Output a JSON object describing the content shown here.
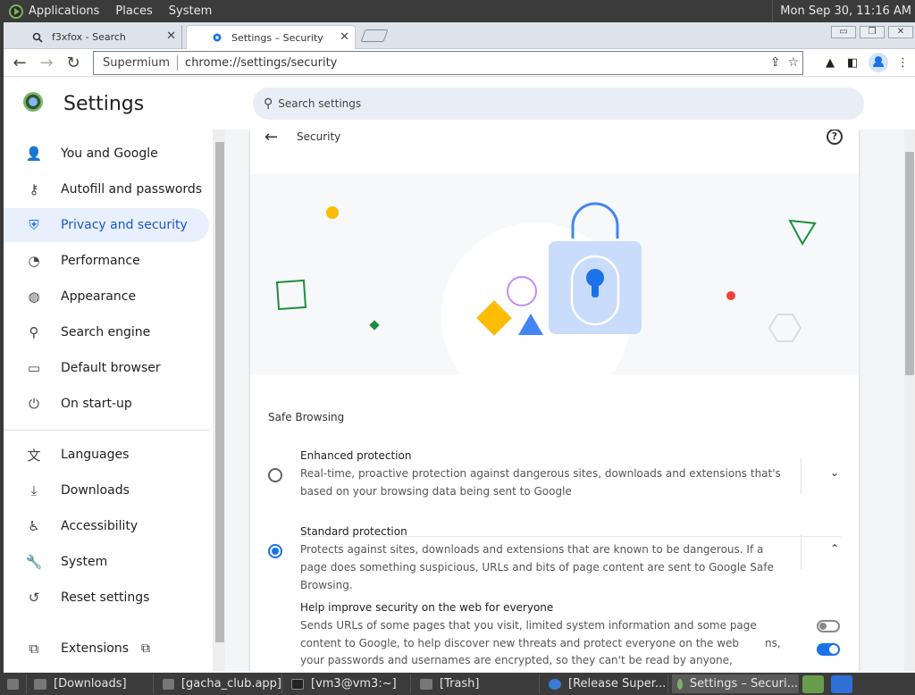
{
  "top_panel": {
    "applications": "Applications",
    "places": "Places",
    "system": "System",
    "clock": "Mon Sep 30, 11:16 AM"
  },
  "tabs": [
    {
      "title": "f3xfox - Search",
      "close": "✕"
    },
    {
      "title": "Settings – Security",
      "close": "✕"
    }
  ],
  "window_controls": [
    "▭",
    "❐",
    "✕"
  ],
  "toolbar": {
    "back": "←",
    "forward": "→",
    "reload": "↻",
    "site_chip": "Supermium",
    "url": "chrome://settings/security"
  },
  "settings": {
    "title": "Settings",
    "search_placeholder": "Search settings"
  },
  "sidebar": {
    "items": [
      {
        "label": "You and Google",
        "icon": "person-icon",
        "glyph": "👤"
      },
      {
        "label": "Autofill and passwords",
        "icon": "key-icon",
        "glyph": "⚷"
      },
      {
        "label": "Privacy and security",
        "icon": "shield-icon",
        "glyph": "⛨"
      },
      {
        "label": "Performance",
        "icon": "gauge-icon",
        "glyph": "◔"
      },
      {
        "label": "Appearance",
        "icon": "palette-icon",
        "glyph": "◍"
      },
      {
        "label": "Search engine",
        "icon": "search-icon",
        "glyph": "⚲"
      },
      {
        "label": "Default browser",
        "icon": "browser-icon",
        "glyph": "▭"
      },
      {
        "label": "On start-up",
        "icon": "power-icon",
        "glyph": "⏻"
      },
      {
        "label": "Languages",
        "icon": "translate-icon",
        "glyph": "文"
      },
      {
        "label": "Downloads",
        "icon": "download-icon",
        "glyph": "⤓"
      },
      {
        "label": "Accessibility",
        "icon": "accessibility-icon",
        "glyph": "♿"
      },
      {
        "label": "System",
        "icon": "wrench-icon",
        "glyph": "🔧"
      },
      {
        "label": "Reset settings",
        "icon": "reset-icon",
        "glyph": "↺"
      },
      {
        "label": "Extensions",
        "icon": "puzzle-icon",
        "glyph": "⧉"
      }
    ],
    "active_index": 2
  },
  "page": {
    "breadcrumb": "Security",
    "section_title": "Safe Browsing",
    "options": [
      {
        "title": "Enhanced protection",
        "desc": "Real-time, proactive protection against dangerous sites, downloads and extensions that's based on your browsing data being sent to Google",
        "selected": false,
        "expanded": false
      },
      {
        "title": "Standard protection",
        "desc": "Protects against sites, downloads and extensions that are known to be dangerous. If a page does something suspicious, URLs and bits of page content are sent to Google Safe Browsing.",
        "selected": true,
        "expanded": true
      }
    ],
    "sub_option": {
      "title": "Help improve security on the web for everyone",
      "desc": "Sends URLs of some pages that you visit, limited system information and some page content to Google, to help discover new threats and protect everyone on the web",
      "desc_tail": "ns,",
      "desc_line3": "your passwords and usernames are encrypted, so they can't be read by anyone, including",
      "toggle1": false,
      "toggle2": true
    }
  },
  "taskbar": {
    "items": [
      {
        "label": "[Downloads]"
      },
      {
        "label": "[gacha_club.app]"
      },
      {
        "label": "[vm3@vm3:~]"
      },
      {
        "label": "[Trash]"
      },
      {
        "label": "[Release Super..."
      },
      {
        "label": "Settings – Securi..."
      }
    ]
  },
  "colors": {
    "accent": "#1a73e8",
    "active_nav_bg": "#e8f0fe"
  }
}
